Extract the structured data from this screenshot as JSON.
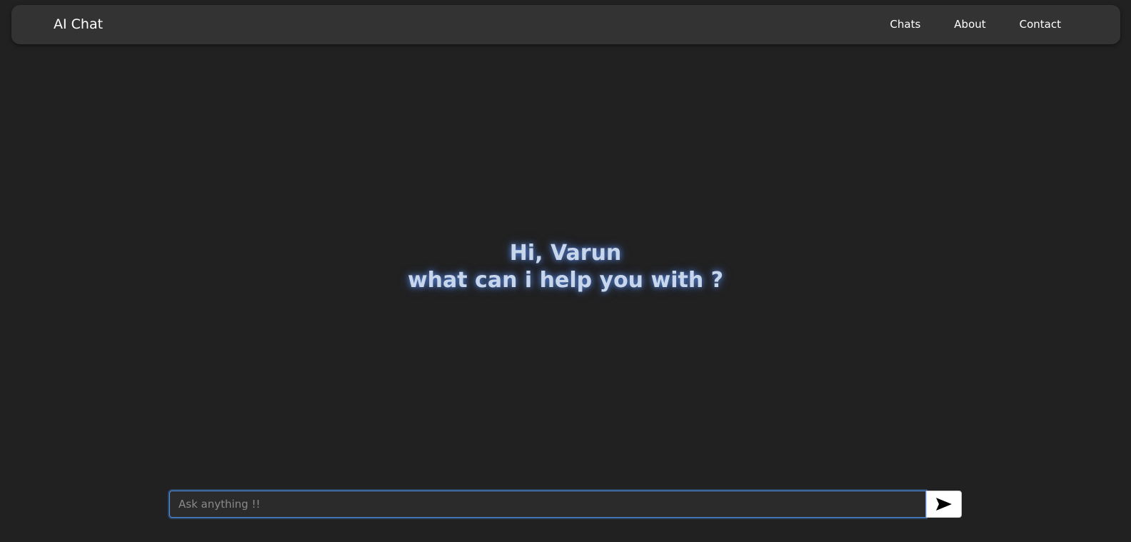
{
  "navbar": {
    "brand": "AI Chat",
    "links": [
      "Chats",
      "About",
      "Contact"
    ]
  },
  "greeting": {
    "line1": "Hi, Varun",
    "line2": "what can i help you with ?"
  },
  "composer": {
    "placeholder": "Ask anything !!",
    "value": "",
    "send_icon": "send-arrow-icon"
  },
  "colors": {
    "background": "#212121",
    "navbar": "#333333",
    "greeting_text": "#c8d6ec",
    "input_focus": "#4d8ee8"
  }
}
